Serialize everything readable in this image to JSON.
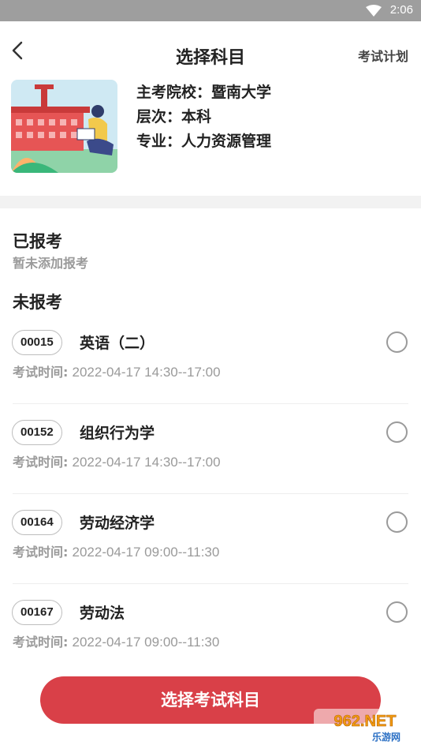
{
  "status_bar": {
    "time": "2:06"
  },
  "header": {
    "title": "选择科目",
    "plan_link": "考试计划"
  },
  "info": {
    "school": "主考院校：暨南大学",
    "level": "层次：本科",
    "major": "专业：人力资源管理"
  },
  "registered": {
    "heading": "已报考",
    "empty_text": "暂未添加报考"
  },
  "unregistered": {
    "heading": "未报考",
    "courses": [
      {
        "code": "00015",
        "name": "英语（二）",
        "time_label": "考试时间:",
        "time": "2022-04-17 14:30--17:00"
      },
      {
        "code": "00152",
        "name": "组织行为学",
        "time_label": "考试时间:",
        "time": "2022-04-17 14:30--17:00"
      },
      {
        "code": "00164",
        "name": "劳动经济学",
        "time_label": "考试时间:",
        "time": "2022-04-17 09:00--11:30"
      },
      {
        "code": "00167",
        "name": "劳动法",
        "time_label": "考试时间:",
        "time": "2022-04-17 09:00--11:30"
      }
    ]
  },
  "submit_button": "选择考试科目",
  "watermark": {
    "brand": "962.NET",
    "sub": "乐游网"
  },
  "colors": {
    "accent": "#d94048",
    "status_bar": "#9e9e9e",
    "muted_text": "#9a9a9a",
    "band": "#f2f2f2"
  }
}
